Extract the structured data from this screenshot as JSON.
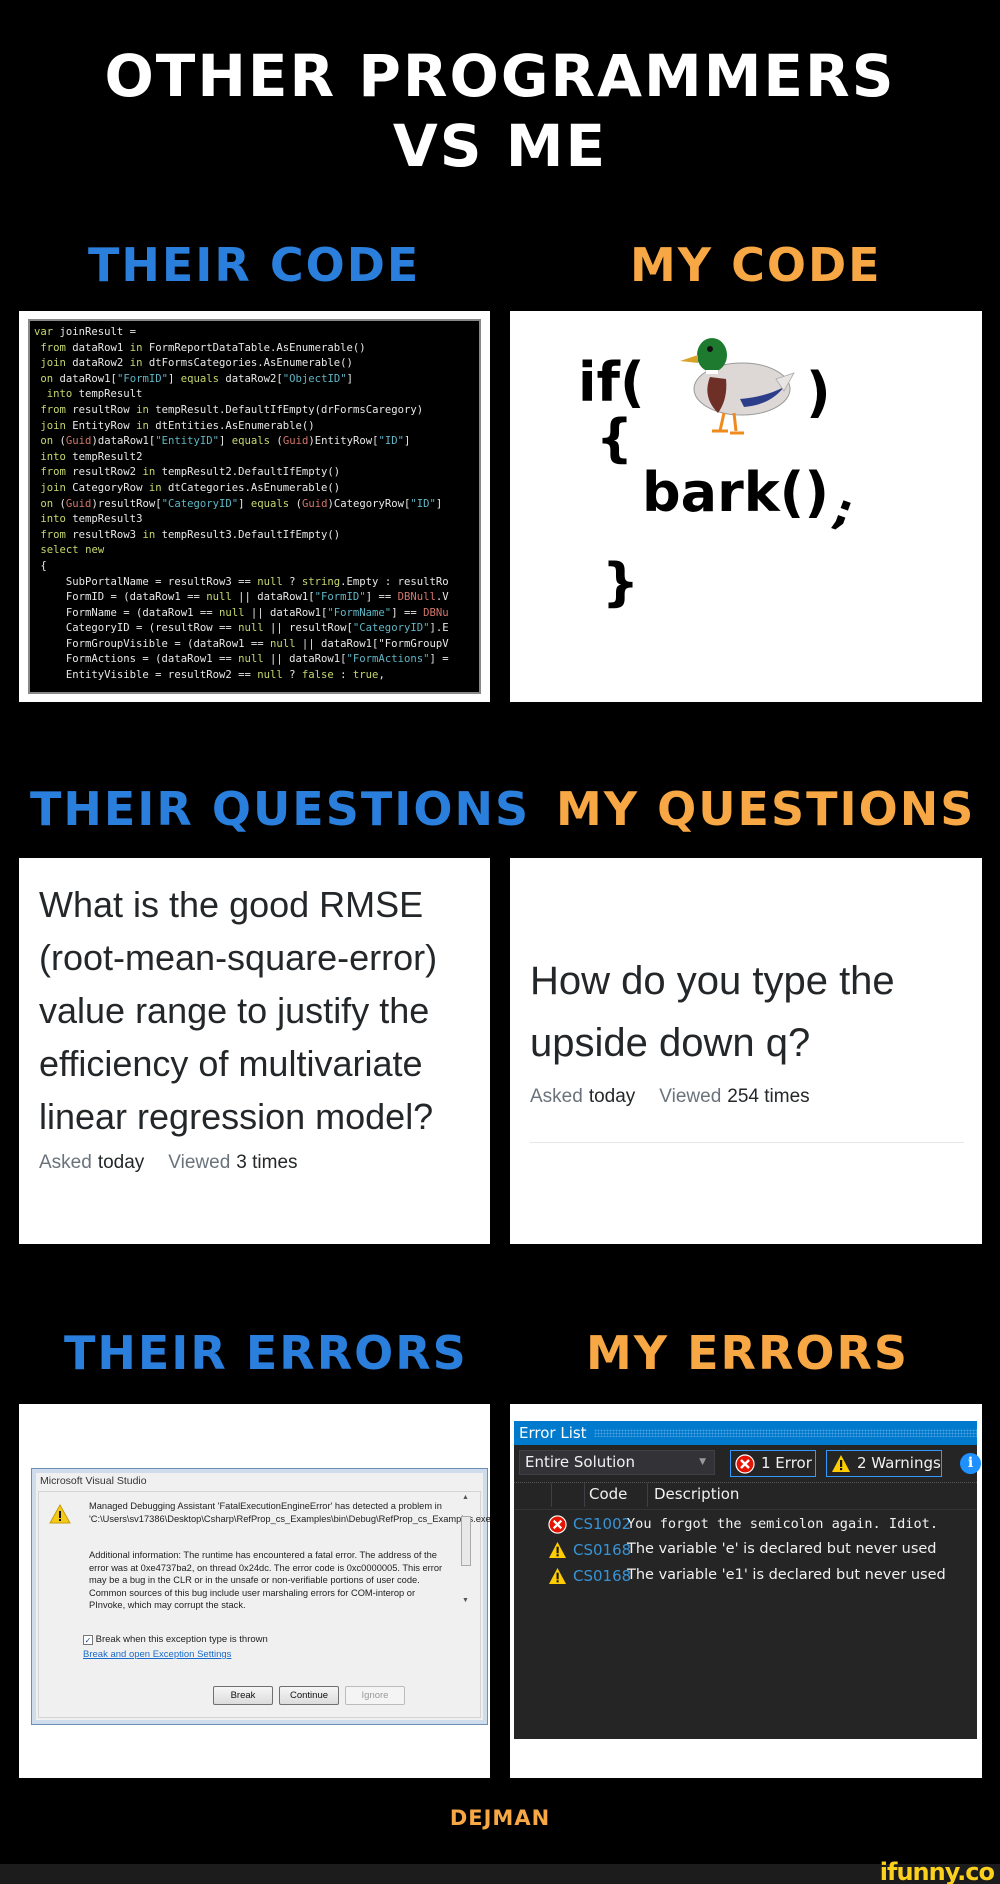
{
  "title": {
    "line1": "OTHER PROGRAMMERS",
    "line2": "VS ME"
  },
  "headings": {
    "their_code": "THEIR CODE",
    "my_code": "MY CODE",
    "their_questions": "THEIR QUESTIONS",
    "my_questions": "MY QUESTIONS",
    "their_errors": "THEIR ERRORS",
    "my_errors": "MY ERRORS"
  },
  "colors": {
    "their": "#2a7fdc",
    "mine": "#f7a844",
    "vs_accent": "#007acc"
  },
  "their_code": {
    "lines": [
      "var joinResult =",
      " from dataRow1 in FormReportDataTable.AsEnumerable()",
      " join dataRow2 in dtFormsCategories.AsEnumerable()",
      " on dataRow1[\"FormID\"] equals dataRow2[\"ObjectID\"]",
      "  into tempResult",
      " from resultRow in tempResult.DefaultIfEmpty(drFormsCaregory)",
      " join EntityRow in dtEntities.AsEnumerable()",
      " on (Guid)dataRow1[\"EntityID\"] equals (Guid)EntityRow[\"ID\"]",
      " into tempResult2",
      " from resultRow2 in tempResult2.DefaultIfEmpty()",
      " join CategoryRow in dtCategories.AsEnumerable()",
      " on (Guid)resultRow[\"CategoryID\"] equals (Guid)CategoryRow[\"ID\"]",
      " into tempResult3",
      " from resultRow3 in tempResult3.DefaultIfEmpty()",
      " select new",
      " {",
      "     SubPortalName = resultRow3 == null ? string.Empty : resultRo",
      "     FormID = (dataRow1 == null || dataRow1[\"FormID\"] == DBNull.V",
      "     FormName = (dataRow1 == null || dataRow1[\"FormName\"] == DBNu",
      "     CategoryID = (resultRow == null || resultRow[\"CategoryID\"].E",
      "     FormGroupVisible = (dataRow1 == null || dataRow1[\"FormGroupV",
      "     FormActions = (dataRow1 == null || dataRow1[\"FormActions\"] =",
      "     EntityVisible = resultRow2 == null ? false : true,"
    ]
  },
  "my_code": {
    "if_kw": "if(",
    "duck_icon": "duck-emoji",
    "close_paren": ")",
    "open_brace": "{",
    "call": "bark()",
    "semicolon": ";",
    "close_brace": "}"
  },
  "their_question": {
    "title": "What is the good RMSE (root-mean-square-error) value range to justify the efficiency of multivariate linear regression model?",
    "asked_label": "Asked",
    "asked_value": "today",
    "viewed_label": "Viewed",
    "viewed_value": "3 times"
  },
  "my_question": {
    "title": "How do you type the upside down q?",
    "asked_label": "Asked",
    "asked_value": "today",
    "viewed_label": "Viewed",
    "viewed_value": "254 times"
  },
  "their_error": {
    "window_title": "Microsoft Visual Studio",
    "message_1": "Managed Debugging Assistant 'FatalExecutionEngineError' has detected a problem in 'C:\\Users\\sv17386\\Desktop\\Csharp\\RefProp_cs_Examples\\bin\\Debug\\RefProp_cs_Examples.exe'.",
    "message_2": "Additional information: The runtime has encountered a fatal error. The address of the error was at 0xe4737ba2, on thread 0x24dc. The error code is 0xc0000005. This error may be a bug in the CLR or in the unsafe or non-verifiable portions of user code. Common sources of this bug include user marshaling errors for COM-interop or PInvoke, which may corrupt the stack.",
    "checkbox_label": "Break when this exception type is thrown",
    "checkbox_checked": true,
    "link": "Break and open Exception Settings",
    "buttons": {
      "break": "Break",
      "continue": "Continue",
      "ignore": "Ignore"
    }
  },
  "my_error": {
    "panel_title": "Error List",
    "filter": "Entire Solution",
    "error_count": "1 Error",
    "warning_count": "2 Warnings",
    "columns": {
      "code": "Code",
      "description": "Description"
    },
    "rows": [
      {
        "type": "error",
        "code": "CS1002",
        "description": "You forgot the semicolon again. Idiot."
      },
      {
        "type": "warning",
        "code": "CS0168",
        "description": "The variable 'e' is declared but never used"
      },
      {
        "type": "warning",
        "code": "CS0168",
        "description": "The variable 'e1' is declared but never used"
      }
    ]
  },
  "footer": {
    "author": "DEJMAN",
    "watermark": "ifunny.co"
  }
}
